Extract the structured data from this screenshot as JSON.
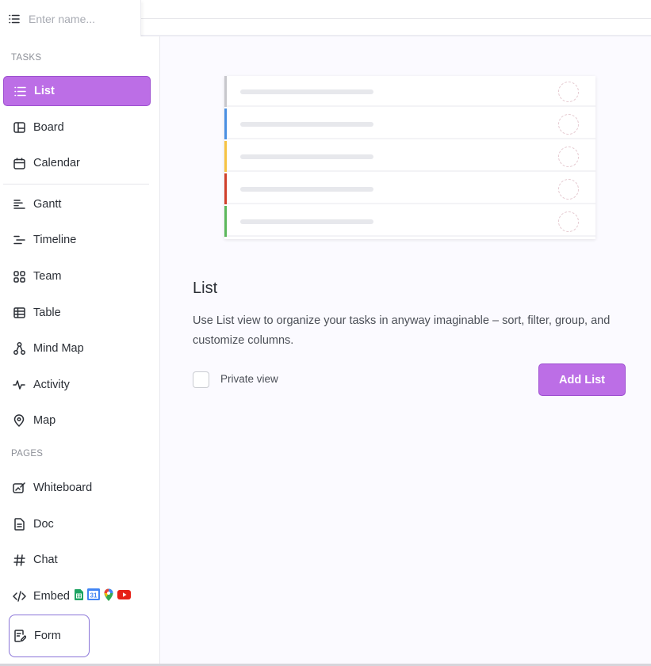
{
  "header": {
    "name_placeholder": "Enter name..."
  },
  "sidebar": {
    "tasks_label": "TASKS",
    "pages_label": "PAGES",
    "tasks": [
      {
        "label": "List",
        "icon": "list-icon",
        "active": true
      },
      {
        "label": "Board",
        "icon": "board-icon"
      },
      {
        "label": "Calendar",
        "icon": "calendar-icon"
      },
      {
        "label": "Gantt",
        "icon": "gantt-icon"
      },
      {
        "label": "Timeline",
        "icon": "timeline-icon"
      },
      {
        "label": "Team",
        "icon": "team-icon"
      },
      {
        "label": "Table",
        "icon": "table-icon"
      },
      {
        "label": "Mind Map",
        "icon": "mind-map-icon"
      },
      {
        "label": "Activity",
        "icon": "activity-icon"
      },
      {
        "label": "Map",
        "icon": "map-pin-icon"
      }
    ],
    "pages": [
      {
        "label": "Whiteboard",
        "icon": "whiteboard-icon"
      },
      {
        "label": "Doc",
        "icon": "doc-icon"
      },
      {
        "label": "Chat",
        "icon": "hash-icon"
      },
      {
        "label": "Embed",
        "icon": "code-icon",
        "apps": [
          "google-sheets-icon",
          "google-calendar-icon",
          "google-maps-icon",
          "youtube-icon"
        ]
      },
      {
        "label": "Form",
        "icon": "form-icon",
        "highlighted": true
      }
    ],
    "calendar_app_day": "31"
  },
  "main": {
    "illustration": {
      "row_colors": [
        "#c7c7cc",
        "#4a90e2",
        "#f6c343",
        "#d0402b",
        "#5cb85c"
      ]
    },
    "title": "List",
    "description": "Use List view to organize your tasks in anyway imaginable – sort, filter, group, and customize columns.",
    "private_view_label": "Private view",
    "private_view_checked": false,
    "add_button_label": "Add List"
  },
  "colors": {
    "accent": "#bc6ee6",
    "accent_border": "#9d4fd0",
    "focus_outline": "#8a74d8"
  }
}
